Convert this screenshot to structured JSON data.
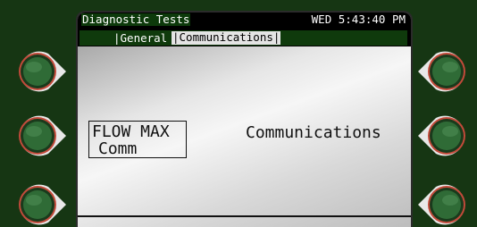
{
  "title_bar": {
    "title": "Diagnostic Tests",
    "clock": "WED 5:43:40 PM"
  },
  "tabs": {
    "general": "|General",
    "communications": "|Communications|"
  },
  "content": {
    "flow_line1": "FLOW MAX",
    "flow_line2": "Comm",
    "comm_label": "Communications"
  },
  "colors": {
    "bezel": "#163613",
    "header_green": "#0f3a0c",
    "button_ring": "#c24a3a",
    "button_green": "#2f6b36"
  },
  "icons": [
    "soft-key-button"
  ]
}
